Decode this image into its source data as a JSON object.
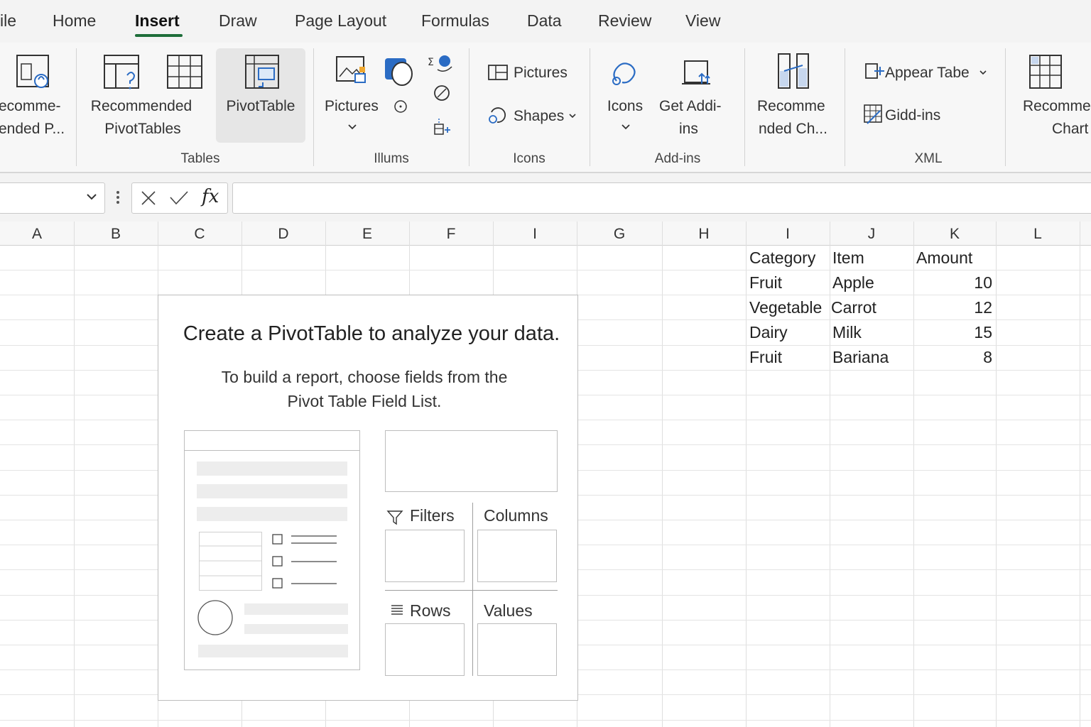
{
  "menu": {
    "tabs": [
      {
        "label": "ile"
      },
      {
        "label": "Home"
      },
      {
        "label": "Insert"
      },
      {
        "label": "Draw"
      },
      {
        "label": "Page Layout"
      },
      {
        "label": "Formulas"
      },
      {
        "label": "Data"
      },
      {
        "label": "Review"
      },
      {
        "label": "View"
      }
    ],
    "active_tab": "Insert"
  },
  "ribbon": {
    "rec_pivot_cut": {
      "line1": "ecomme-",
      "line2": "ended P..."
    },
    "recommended_pivottables": {
      "line1": "Recommended",
      "line2": "PivotTables"
    },
    "pivottable": "PivotTable",
    "pictures_big": "Pictures",
    "pictures_small": "Pictures",
    "shapes": "Shapes",
    "icons": "Icons",
    "get_addins": {
      "line1": "Get Addi-",
      "line2": "ins"
    },
    "rec_charts": {
      "line1": "Recomme",
      "line2": "nded Ch..."
    },
    "appear_tabe": "Appear Tabe",
    "gidd_ins": "Gidd-ins",
    "rec_chart_cut": {
      "line1": "Recomme",
      "line2": "Chart"
    },
    "groups": {
      "tables": "Tables",
      "illums": "Illums",
      "icons": "Icons",
      "addins": "Add-ins",
      "xml": "XML"
    }
  },
  "formula_bar": {
    "name_box": "",
    "fx": "fx",
    "value": ""
  },
  "columns": [
    "A",
    "B",
    "C",
    "D",
    "E",
    "F",
    "I",
    "G",
    "H",
    "I",
    "J",
    "K",
    "L"
  ],
  "sheet": {
    "headers": [
      "Category",
      "Item",
      "Amount"
    ],
    "rows": [
      {
        "category": "Fruit",
        "item": "Apple",
        "amount": "10"
      },
      {
        "category": "Vegetable",
        "item": "Carrot",
        "amount": "12"
      },
      {
        "category": "Dairy",
        "item": "Milk",
        "amount": "15"
      },
      {
        "category": "Fruit",
        "item": "Bariana",
        "amount": "8"
      }
    ]
  },
  "pivot_placeholder": {
    "title": "Create a PivotTable to analyze your data.",
    "subtitle_line1": "To build a report, choose fields from the",
    "subtitle_line2": "Pivot Table Field List.",
    "areas": {
      "filters": "Filters",
      "columns": "Columns",
      "rows": "Rows",
      "values": "Values"
    }
  },
  "colors": {
    "accent_green": "#1e6e3a",
    "icon_blue": "#2b6cc4"
  }
}
